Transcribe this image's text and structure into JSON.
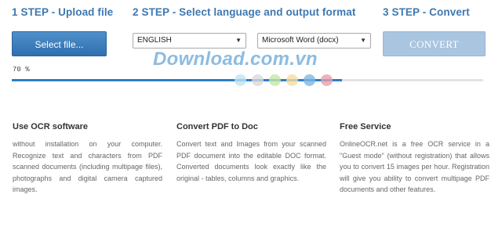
{
  "steps": {
    "step1_title": "1 STEP - Upload file",
    "step2_title": "2 STEP - Select language and output format",
    "step3_title": "3 STEP - Convert"
  },
  "upload": {
    "button_label": "Select file..."
  },
  "language_select": {
    "selected": "ENGLISH"
  },
  "format_select": {
    "selected": "Microsoft Word (docx)"
  },
  "convert": {
    "button_label": "CONVERT"
  },
  "watermark": {
    "text": "Download.com.vn"
  },
  "progress": {
    "label": "70 %",
    "fraction": 0.7
  },
  "dot_colors": [
    "#bfe3f3",
    "#dadada",
    "#c6e6a8",
    "#f6dca0",
    "#7fb6e0",
    "#e5a0ac"
  ],
  "colors": {
    "accent": "#3e78b0",
    "button": "#3b7cbd",
    "convert_disabled": "#a9c5e0",
    "progress_fill": "#2a7fc7"
  },
  "features": [
    {
      "title": "Use OCR software",
      "text": "without installation on your computer. Recognize text and characters from PDF scanned documents (including multipage files), photographs and digital camera captured images."
    },
    {
      "title": "Convert PDF to Doc",
      "text": "Convert text and Images from your scanned PDF document into the editable DOC format. Converted documents look exactly like the original - tables, columns and graphics."
    },
    {
      "title": "Free Service",
      "text": "OnlineOCR.net is a free OCR service in a \"Guest mode\" (without registration) that allows you to convert 15 images per hour. Registration will give you ability to convert multipage PDF documents and other features."
    }
  ]
}
